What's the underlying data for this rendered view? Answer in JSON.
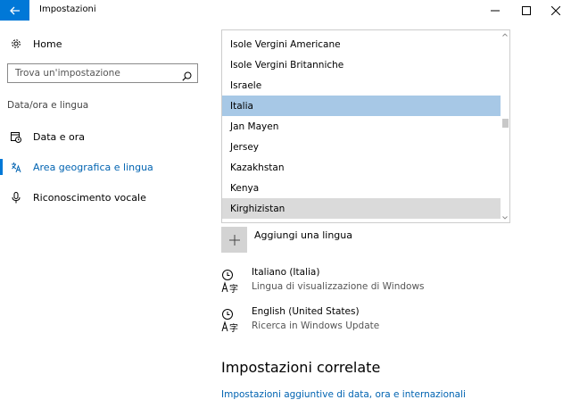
{
  "window": {
    "title": "Impostazioni",
    "minimize_glyph": "—",
    "maximize_glyph": "☐",
    "close_glyph": "✕",
    "accent": "#0078d7"
  },
  "sidebar": {
    "home_label": "Home",
    "search_placeholder": "Trova un'impostazione",
    "section_label": "Data/ora e lingua",
    "items": [
      {
        "label": "Data e ora",
        "icon": "calendar-clock-icon",
        "active": false
      },
      {
        "label": "Area geografica e lingua",
        "icon": "region-language-icon",
        "active": true
      },
      {
        "label": "Riconoscimento vocale",
        "icon": "microphone-icon",
        "active": false
      }
    ]
  },
  "dropdown": {
    "items": [
      {
        "label": "Isole Vergini Americane",
        "state": "normal"
      },
      {
        "label": "Isole Vergini Britanniche",
        "state": "normal"
      },
      {
        "label": "Israele",
        "state": "normal"
      },
      {
        "label": "Italia",
        "state": "selected"
      },
      {
        "label": "Jan Mayen",
        "state": "normal"
      },
      {
        "label": "Jersey",
        "state": "normal"
      },
      {
        "label": "Kazakhstan",
        "state": "normal"
      },
      {
        "label": "Kenya",
        "state": "normal"
      },
      {
        "label": "Kirghizistan",
        "state": "hover"
      }
    ],
    "selected_color": "#a7c8e6",
    "hover_color": "#dadada"
  },
  "main": {
    "add_language_label": "Aggiungi una lingua",
    "languages": [
      {
        "name": "Italiano (Italia)",
        "description": "Lingua di visualizzazione di Windows"
      },
      {
        "name": "English (United States)",
        "description": "Ricerca in Windows Update"
      }
    ],
    "related_title": "Impostazioni correlate",
    "related_link": "Impostazioni aggiuntive di data, ora e internazionali",
    "link_color": "#0063b1"
  }
}
